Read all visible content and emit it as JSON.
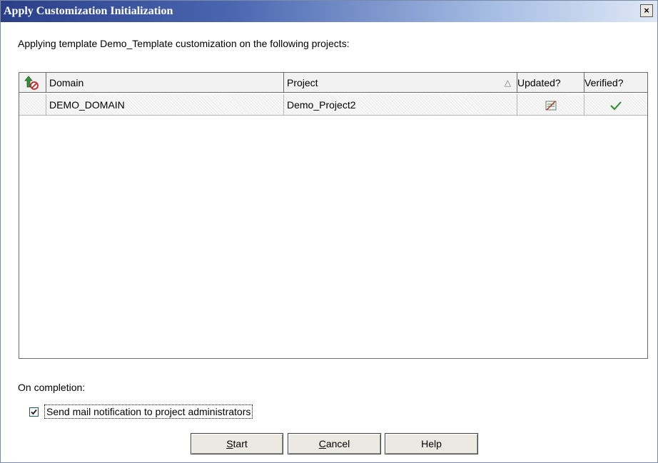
{
  "window": {
    "title": "Apply Customization Initialization",
    "close_label": "×"
  },
  "intro_text": "Applying template Demo_Template customization on the following projects:",
  "grid": {
    "columns": {
      "status_icon": "status-column-icon",
      "domain": "Domain",
      "project": "Project",
      "sort_indicator": "△",
      "updated": "Updated?",
      "verified": "Verified?"
    },
    "rows": [
      {
        "domain": "DEMO_DOMAIN",
        "project": "Demo_Project2",
        "updated_icon": "not-updated-icon",
        "verified_icon": "checkmark-icon"
      }
    ]
  },
  "completion": {
    "label": "On completion:",
    "send_mail_label": "Send mail notification to project administrators",
    "send_mail_checked": true
  },
  "buttons": {
    "start_first": "S",
    "start_rest": "tart",
    "cancel_first": "C",
    "cancel_rest": "ancel",
    "help": "Help"
  },
  "colors": {
    "title_start": "#2a3f88",
    "title_end": "#dfe8f6",
    "check_green": "#2a8a2a"
  }
}
